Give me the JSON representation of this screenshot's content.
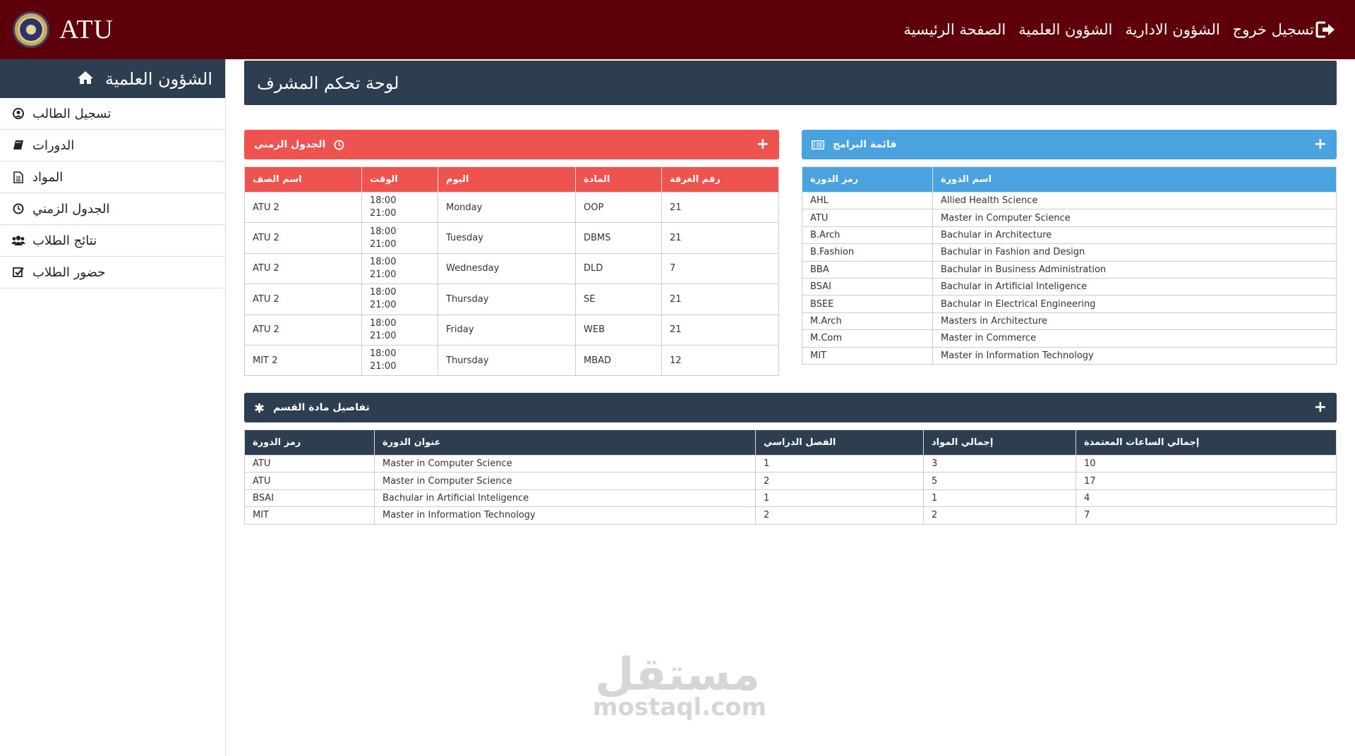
{
  "brand": {
    "name": "ATU"
  },
  "topnav": {
    "logout": "تسجيل خروج",
    "admin_affairs": "الشؤون الادارية",
    "academic_affairs": "الشؤون العلمية",
    "home": "الصفحة الرئيسية"
  },
  "sidebar": {
    "title": "الشؤون العلمية",
    "items": [
      {
        "label": "تسجيل الطالب",
        "icon": "user-circle-icon"
      },
      {
        "label": "الدورات",
        "icon": "book-icon"
      },
      {
        "label": "المواد",
        "icon": "file-text-icon"
      },
      {
        "label": "الجدول الزمني",
        "icon": "clock-icon"
      },
      {
        "label": "نتائج الطلاب",
        "icon": "users-icon"
      },
      {
        "label": "حضور الطلاب",
        "icon": "checkbox-icon"
      }
    ]
  },
  "page": {
    "title": "لوحة تحكم المشرف"
  },
  "timetable": {
    "title": "الجدول الزمني",
    "color": "#ef5350",
    "headers": [
      "اسم الصف",
      "الوقت",
      "اليوم",
      "المادة",
      "رقم الغرفة"
    ],
    "rows": [
      {
        "class": "ATU 2",
        "start": "18:00",
        "end": "21:00",
        "day": "Monday",
        "subject": "OOP",
        "room": "21"
      },
      {
        "class": "ATU 2",
        "start": "18:00",
        "end": "21:00",
        "day": "Tuesday",
        "subject": "DBMS",
        "room": "21"
      },
      {
        "class": "ATU 2",
        "start": "18:00",
        "end": "21:00",
        "day": "Wednesday",
        "subject": "DLD",
        "room": "7"
      },
      {
        "class": "ATU 2",
        "start": "18:00",
        "end": "21:00",
        "day": "Thursday",
        "subject": "SE",
        "room": "21"
      },
      {
        "class": "ATU 2",
        "start": "18:00",
        "end": "21:00",
        "day": "Friday",
        "subject": "WEB",
        "room": "21"
      },
      {
        "class": "MIT 2",
        "start": "18:00",
        "end": "21:00",
        "day": "Thursday",
        "subject": "MBAD",
        "room": "12"
      }
    ]
  },
  "programs": {
    "title": "قائمة البرامج",
    "color": "#4aa3df",
    "headers": [
      "رمز الدورة",
      "اسم الدورة"
    ],
    "rows": [
      {
        "code": "AHL",
        "name": "Allied Health Science"
      },
      {
        "code": "ATU",
        "name": "Master in Computer Science"
      },
      {
        "code": "B.Arch",
        "name": "Bachular in Architecture"
      },
      {
        "code": "B.Fashion",
        "name": "Bachular in Fashion and Design"
      },
      {
        "code": "BBA",
        "name": "Bachular in Business Administration"
      },
      {
        "code": "BSAI",
        "name": "Bachular in Artificial Inteligence"
      },
      {
        "code": "BSEE",
        "name": "Bachular in Electrical Engineering"
      },
      {
        "code": "M.Arch",
        "name": "Masters in Architecture"
      },
      {
        "code": "M.Com",
        "name": "Master in Commerce"
      },
      {
        "code": "MIT",
        "name": "Master in Information Technology"
      }
    ]
  },
  "course_details": {
    "title": "تفاصيل مادة القسم",
    "color": "#2c3e50",
    "headers": [
      "رمز الدورة",
      "عنوان الدورة",
      "الفصل الدراسي",
      "إجمالي المواد",
      "إجمالي الساعات المعتمدة"
    ],
    "rows": [
      {
        "code": "ATU",
        "title": "Master in Computer Science",
        "semester": "1",
        "subjects": "3",
        "hours": "10"
      },
      {
        "code": "ATU",
        "title": "Master in Computer Science",
        "semester": "2",
        "subjects": "5",
        "hours": "17"
      },
      {
        "code": "BSAI",
        "title": "Bachular in Artificial Inteligence",
        "semester": "1",
        "subjects": "1",
        "hours": "4"
      },
      {
        "code": "MIT",
        "title": "Master in Information Technology",
        "semester": "2",
        "subjects": "2",
        "hours": "7"
      }
    ]
  },
  "watermark": {
    "arabic": "مستقل",
    "latin": "mostaql.com"
  }
}
